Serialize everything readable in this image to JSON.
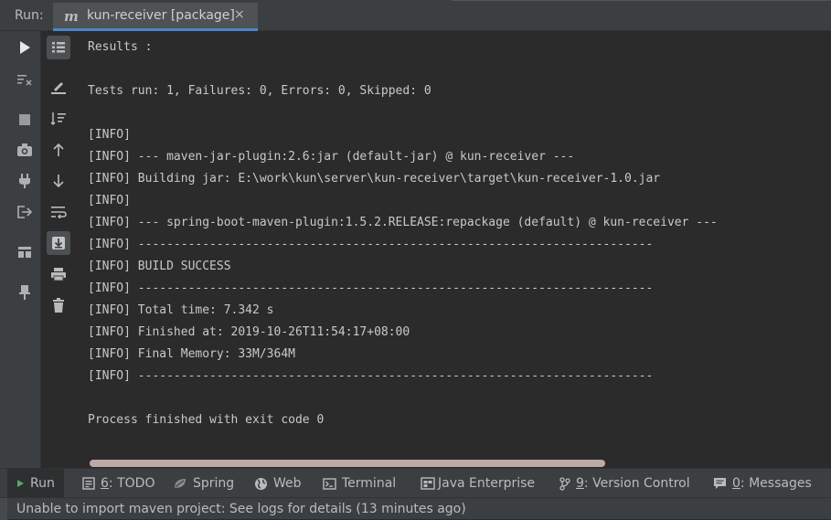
{
  "header": {
    "run_label": "Run:",
    "tab_icon_letter": "m",
    "tab_title": "kun-receiver [package]",
    "close_glyph": "×"
  },
  "toolbar": {
    "left": [
      "rerun-icon",
      "clear-filter-icon",
      "stop-icon",
      "camera-icon",
      "plug-icon",
      "exit-icon",
      "layout-icon",
      "pin-icon"
    ],
    "right": [
      "list-icon",
      "edit-icon",
      "sort-icon",
      "arrow-up-icon",
      "arrow-down-icon",
      "soft-wrap-icon",
      "scroll-to-end-icon",
      "print-icon",
      "trash-icon"
    ]
  },
  "console": {
    "lines": [
      "Results :",
      "",
      "Tests run: 1, Failures: 0, Errors: 0, Skipped: 0",
      "",
      "[INFO]",
      "[INFO] --- maven-jar-plugin:2.6:jar (default-jar) @ kun-receiver ---",
      "[INFO] Building jar: E:\\work\\kun\\server\\kun-receiver\\target\\kun-receiver-1.0.jar",
      "[INFO]",
      "[INFO] --- spring-boot-maven-plugin:1.5.2.RELEASE:repackage (default) @ kun-receiver ---",
      "[INFO] ------------------------------------------------------------------------",
      "[INFO] BUILD SUCCESS",
      "[INFO] ------------------------------------------------------------------------",
      "[INFO] Total time: 7.342 s",
      "[INFO] Finished at: 2019-10-26T11:54:17+08:00",
      "[INFO] Final Memory: 33M/364M",
      "[INFO] ------------------------------------------------------------------------",
      "",
      "Process finished with exit code 0"
    ]
  },
  "bottom_tabs": {
    "run": "Run",
    "todo_num": "6",
    "todo_rest": ": TODO",
    "spring": "Spring",
    "web": "Web",
    "terminal": "Terminal",
    "java_enterprise": "Java Enterprise",
    "vc_num": "9",
    "vc_rest": ": Version Control",
    "messages_num": "0",
    "messages_rest": ": Messages"
  },
  "status": {
    "text": "Unable to import maven project: See logs for details (13 minutes ago)"
  },
  "colors": {
    "background": "#2b2b2b",
    "panel": "#3c3f41",
    "tab_underline": "#4a88c7",
    "run_green": "#59a869",
    "scroll_thumb": "#bcaaa4"
  }
}
